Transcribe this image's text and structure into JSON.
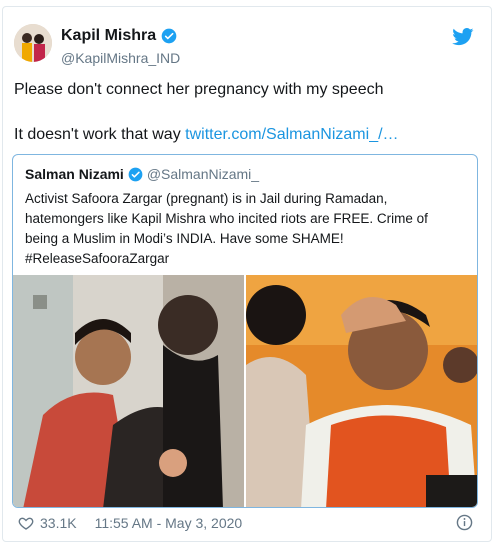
{
  "tweet": {
    "author": {
      "name": "Kapil Mishra",
      "handle": "@KapilMishra_IND"
    },
    "text_line1": "Please don't connect her pregnancy with my speech",
    "text_line2": "It doesn't work that way ",
    "link": "twitter.com/SalmanNizami_/…",
    "likes": "33.1K",
    "timestamp": "11:55 AM - May 3, 2020"
  },
  "quote": {
    "author": {
      "name": "Salman Nizami",
      "handle": "@SalmanNizami_"
    },
    "lines": [
      "Activist Safoora Zargar (pregnant) is in Jail during Ramadan,",
      "hatemongers like Kapil Mishra who incited riots are FREE. Crime of",
      "being a Muslim in Modi’s INDIA. Have some SHAME!",
      "#ReleaseSafooraZargar"
    ]
  },
  "colors": {
    "accent": "#1da1f2",
    "link": "#1b95e0",
    "muted": "#657786",
    "border": "#7fb6e0"
  },
  "icons": [
    "twitter-bird-icon",
    "verified-badge-icon",
    "heart-icon",
    "info-icon"
  ]
}
